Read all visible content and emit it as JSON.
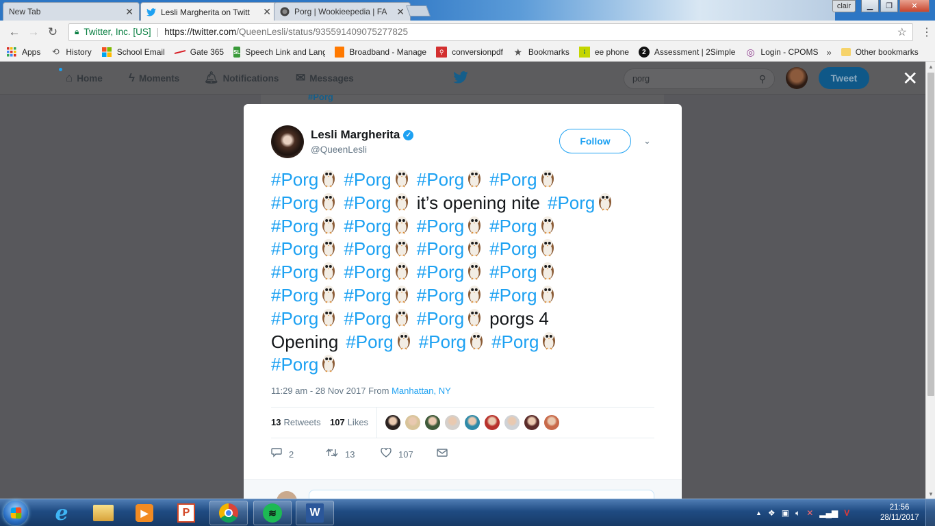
{
  "browser": {
    "tabs": [
      {
        "title": "New Tab",
        "active": false
      },
      {
        "title": "Lesli Margherita on Twitt",
        "active": true
      },
      {
        "title": "Porg | Wookieepedia | FA",
        "active": false
      }
    ],
    "profile_name": "clair",
    "address": {
      "site_identity": "Twitter, Inc. [US]",
      "url_host": "https://twitter.com",
      "url_path": "/QueenLesli/status/935591409075277825"
    },
    "bookmarks": [
      {
        "label": "Apps",
        "icon": "apps-grid-icon"
      },
      {
        "label": "History",
        "icon": "history-icon"
      },
      {
        "label": "School Email",
        "icon": "microsoft-icon"
      },
      {
        "label": "Gate 365",
        "icon": "gate365-icon"
      },
      {
        "label": "Speech Link and Lang",
        "icon": "speechlink-icon"
      },
      {
        "label": "Broadband - Manage",
        "icon": "broadband-icon"
      },
      {
        "label": "conversionpdf",
        "icon": "pdf-icon"
      },
      {
        "label": "Bookmarks",
        "icon": "star-icon"
      },
      {
        "label": "ee phone",
        "icon": "ee-icon"
      },
      {
        "label": "Assessment | 2Simple",
        "icon": "2simple-icon"
      },
      {
        "label": "Login - CPOMS",
        "icon": "cpoms-icon"
      }
    ],
    "bookmarks_overflow": "»",
    "other_bookmarks": "Other bookmarks"
  },
  "twitter_nav": {
    "items": [
      {
        "label": "Home",
        "icon": "home-icon"
      },
      {
        "label": "Moments",
        "icon": "lightning-icon"
      },
      {
        "label": "Notifications",
        "icon": "bell-icon"
      },
      {
        "label": "Messages",
        "icon": "envelope-icon"
      }
    ],
    "search_value": "porg",
    "tweet_button": "Tweet",
    "close_glyph": "✕",
    "background_snippet": "#Porg"
  },
  "tweet": {
    "author_name": "Lesli Margherita",
    "author_handle": "@QueenLesli",
    "verified": true,
    "follow_label": "Follow",
    "hashtag": "#Porg",
    "lines": [
      [
        "#Porg",
        "#Porg",
        "#Porg",
        "#Porg"
      ],
      [
        "#Porg",
        "#Porg",
        "it’s opening nite",
        "#Porg"
      ],
      [
        "#Porg",
        "#Porg",
        "#Porg",
        "#Porg"
      ],
      [
        "#Porg",
        "#Porg",
        "#Porg",
        "#Porg"
      ],
      [
        "#Porg",
        "#Porg",
        "#Porg",
        "#Porg"
      ],
      [
        "#Porg",
        "#Porg",
        "#Porg",
        "#Porg"
      ],
      [
        "#Porg",
        "#Porg",
        "#Porg",
        "porgs 4"
      ],
      [
        "Opening",
        "#Porg",
        "#Porg",
        "#Porg"
      ],
      [
        "#Porg"
      ]
    ],
    "timestamp": "11:29 am - 28 Nov 2017 From",
    "location": "Manhattan, NY",
    "retweets_count": "13",
    "retweets_label": "Retweets",
    "likes_count": "107",
    "likes_label": "Likes",
    "liker_colors": [
      "#2b2220",
      "#d8c49a",
      "#3f5a3a",
      "#d4d0cc",
      "#2f8aa8",
      "#b8322c",
      "#cfd2d6",
      "#5b2c2a",
      "#c86a4a"
    ],
    "actions": {
      "replies": "2",
      "retweets": "13",
      "likes": "107"
    }
  },
  "taskbar": {
    "clock_time": "21:56",
    "clock_date": "28/11/2017"
  },
  "colors": {
    "twitter_blue": "#1da1f2",
    "overlay": "#58585c",
    "text_dark": "#14171a",
    "text_muted": "#657786"
  }
}
